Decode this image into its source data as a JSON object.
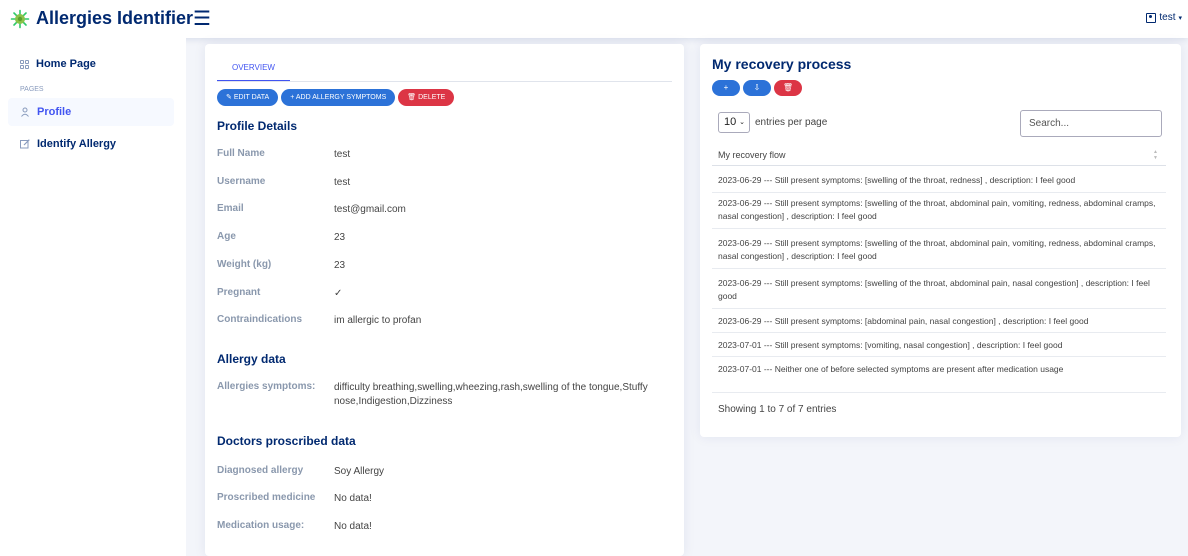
{
  "header": {
    "app_title": "Allergies Identifier",
    "logo_icon": "virus-icon",
    "menu_icon": "hamburger-icon",
    "user_name": "test",
    "colors": {
      "brand": "#012970",
      "logo": "#2eca6a",
      "accent": "#4154f1"
    }
  },
  "sidebar": {
    "home_label": "Home Page",
    "pages_heading": "PAGES",
    "profile_label": "Profile",
    "identify_label": "Identify Allergy"
  },
  "profile": {
    "tab_label": "OVERVIEW",
    "buttons": {
      "edit": "EDIT DATA",
      "add": "+ ADD ALLERGY SYMPTOMS",
      "delete": "DELETE"
    },
    "details_title": "Profile Details",
    "details": [
      {
        "label": "Full Name",
        "value": "test"
      },
      {
        "label": "Username",
        "value": "test"
      },
      {
        "label": "Email",
        "value": "test@gmail.com"
      },
      {
        "label": "Age",
        "value": "23"
      },
      {
        "label": "Weight (kg)",
        "value": "23"
      },
      {
        "label": "Pregnant",
        "value": "✓"
      },
      {
        "label": "Contraindications",
        "value": "im allergic to profan"
      }
    ],
    "allergy_title": "Allergy data",
    "allergy_label": "Allergies symptoms:",
    "allergy_value": "difficulty breathing,swelling,wheezing,rash,swelling of the tongue,Stuffy nose,Indigestion,Dizziness",
    "doctor_title": "Doctors proscribed data",
    "doctor": [
      {
        "label": "Diagnosed allergy",
        "value": "Soy Allergy"
      },
      {
        "label": "Proscribed medicine",
        "value": "No data!"
      },
      {
        "label": "Medication usage:",
        "value": "No data!"
      }
    ]
  },
  "recovery": {
    "title": "My recovery process",
    "buttons": {
      "add": "+",
      "download": "⇩",
      "delete": "🗑"
    },
    "entries_select": "10",
    "entries_per_page": "entries per page",
    "search_placeholder": "Search...",
    "column_header": "My recovery flow",
    "rows": [
      "2023-06-29 --- Still present symptoms: [swelling of the throat, redness] , description: I feel good",
      "2023-06-29 --- Still present symptoms: [swelling of the throat, abdominal pain, vomiting, redness, abdominal cramps, nasal congestion] , description: I feel good",
      "2023-06-29 --- Still present symptoms: [swelling of the throat, abdominal pain, vomiting, redness, abdominal cramps, nasal congestion] , description: I feel good",
      "2023-06-29 --- Still present symptoms: [swelling of the throat, abdominal pain, nasal congestion] , description: I feel good",
      "2023-06-29 --- Still present symptoms: [abdominal pain, nasal congestion] , description: I feel good",
      "2023-07-01 --- Still present symptoms: [vomiting, nasal congestion] , description: I feel good",
      "2023-07-01 --- Neither one of before selected symptoms are present after medication usage"
    ],
    "footer": "Showing 1 to 7 of 7 entries"
  }
}
